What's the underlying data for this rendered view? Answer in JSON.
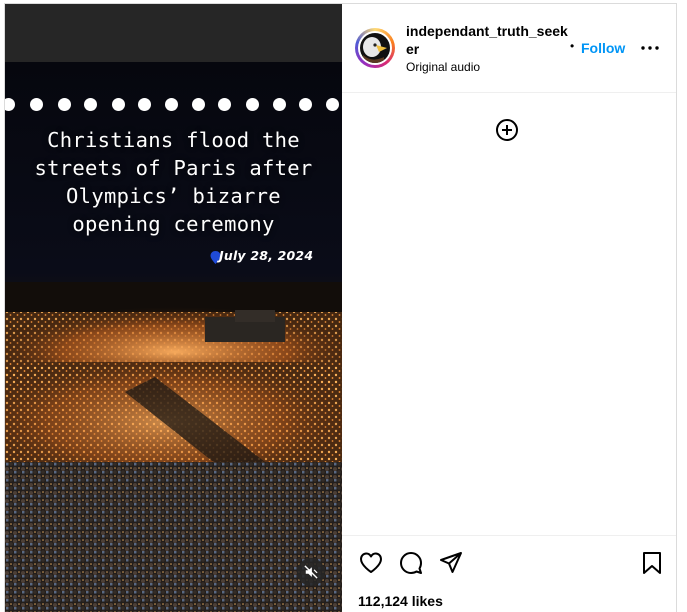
{
  "post": {
    "media": {
      "caption_lines": [
        "Christians flood the",
        "streets of Paris after",
        "Olympics’ bizarre",
        "opening ceremony"
      ],
      "date": "July 28, 2024",
      "mute_icon": "muted-speaker-icon"
    },
    "header": {
      "username": "independant_truth_seeker",
      "audio": "Original audio",
      "separator": "•",
      "follow_label": "Follow",
      "more_icon": "more-options-icon"
    },
    "comments": {
      "add_icon": "add-circle-icon"
    },
    "actions": {
      "icons": [
        "heart-icon",
        "comment-icon",
        "share-icon",
        "save-icon"
      ],
      "likes": "112,124 likes"
    },
    "colors": {
      "follow": "#0095f6",
      "border": "#dbdbdb"
    }
  }
}
